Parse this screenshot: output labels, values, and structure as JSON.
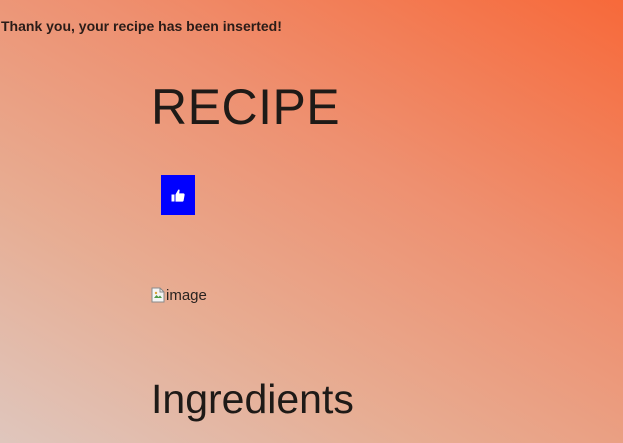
{
  "flash": {
    "message": "Thank you, your recipe has been inserted!"
  },
  "recipe": {
    "title": "RECIPE",
    "like_icon": "thumbs-up-icon",
    "image_alt": "image",
    "ingredients_heading": "Ingredients"
  },
  "colors": {
    "like_button": "#0000ff",
    "gradient_start": "#dfc6bd",
    "gradient_end": "#f7693a"
  }
}
